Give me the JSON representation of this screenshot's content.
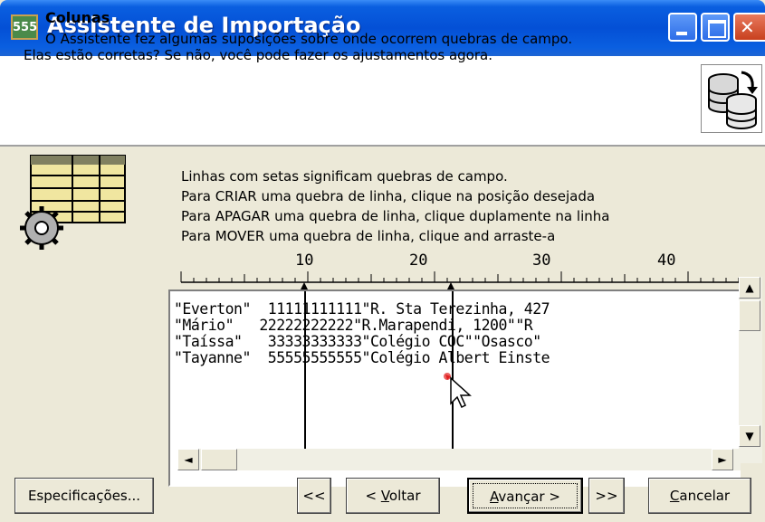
{
  "window": {
    "title": "Assistente de Importação",
    "icon_label": "555"
  },
  "header": {
    "title": "Colunas",
    "description": "O Assistente fez algumas suposições sobre onde ocorrem quebras de campo. Elas estão corretas? Se não, você pode fazer os ajustamentos agora."
  },
  "instructions": [
    "Linhas com setas significam quebras de campo.",
    "Para CRIAR uma quebra de linha, clique na posição desejada",
    "Para APAGAR uma quebra de linha, clique duplamente na linha",
    "Para MOVER uma quebra de linha, clique and arraste-a"
  ],
  "ruler": {
    "labels": [
      "10",
      "20",
      "30",
      "40"
    ]
  },
  "preview_rows": [
    "\"Everton\"  11111111111\"R. Sta Terezinha, 427",
    "\"Mário\"   22222222222\"R.Marapendi, 1200\"\"R",
    "\"Taíssa\"   33333333333\"Colégio COC\"\"Osasco\"",
    "\"Tayanne\"  55555555555\"Colégio Albert Einste"
  ],
  "buttons": {
    "advanced": "Especificações...",
    "first": "<<",
    "back_prefix": "< ",
    "back_underlined": "V",
    "back_rest": "oltar",
    "next_underlined": "A",
    "next_rest": "vançar >",
    "last": ">>",
    "cancel_underlined": "C",
    "cancel_rest": "ancelar"
  },
  "scroll_arrows": {
    "up": "▲",
    "down": "▼",
    "left": "◄",
    "right": "►"
  }
}
